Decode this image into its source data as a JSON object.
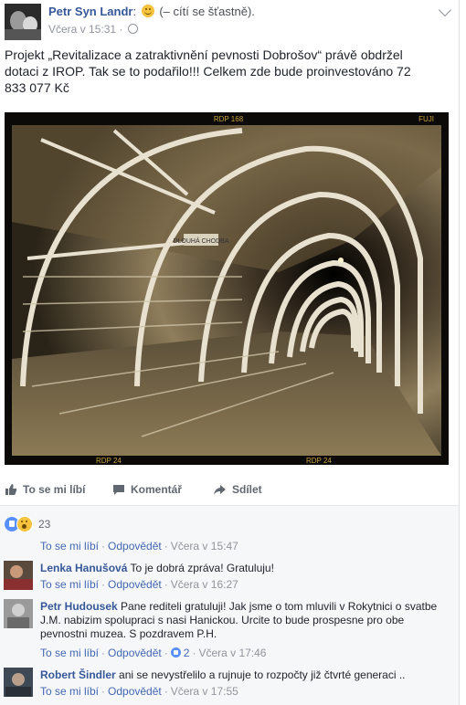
{
  "post": {
    "author": "Petr Syn Landr",
    "feeling_text": "(– cítí se šťastně).",
    "timestamp": "Včera v 15:31",
    "meta_sep": "·",
    "text": "Projekt „Revitalizace a zatraktivnění pevnosti Dobrošov“ právě obdržel dotaci z IROP. Tak se to podařilo!!! Celkem zde bude proinvestováno 72 833 077 Kč",
    "photo_marks": {
      "top": "RDP 168",
      "corner": "FUJI",
      "bottom_left": "RDP 24",
      "bottom_right": "RDP 24"
    },
    "photo_sign": "DLOUHÁ CHODBA"
  },
  "actions": {
    "like": "To se mi líbí",
    "comment": "Komentář",
    "share": "Sdílet"
  },
  "reactions": {
    "count": "23",
    "types": [
      "like-icon",
      "wow-icon"
    ]
  },
  "post_line": {
    "like": "To se mi líbí",
    "reply": "Odpovědět",
    "time": "Včera v 15:47"
  },
  "comments": [
    {
      "author": "Lenka Hanušová",
      "text": "To je dobrá zpráva! Gratuluju!",
      "like": "To se mi líbí",
      "reply": "Odpovědět",
      "time": "Včera v 16:27",
      "likes": ""
    },
    {
      "author": "Petr Hudousek",
      "text": "Pane rediteli gratuluji! Jak jsme o tom mluvili v Rokytnici o svatbe J.M. nabizim spolupraci s nasi Hanickou. Urcite to bude prospesne pro obe pevnostni muzea. S pozdravem P.H.",
      "like": "To se mi líbí",
      "reply": "Odpovědět",
      "time": "Včera v 17:46",
      "likes": "2"
    },
    {
      "author": "Robert Šindler",
      "text": "ani se nevystřelilo a rujnuje to rozpočty již čtvrté generaci ..",
      "like": "To se mi líbí",
      "reply": "Odpovědět",
      "time": "Včera v 17:55",
      "likes": ""
    }
  ],
  "colors": {
    "link": "#365899",
    "meta": "#90949c",
    "reaction_like": "#5890ff"
  }
}
